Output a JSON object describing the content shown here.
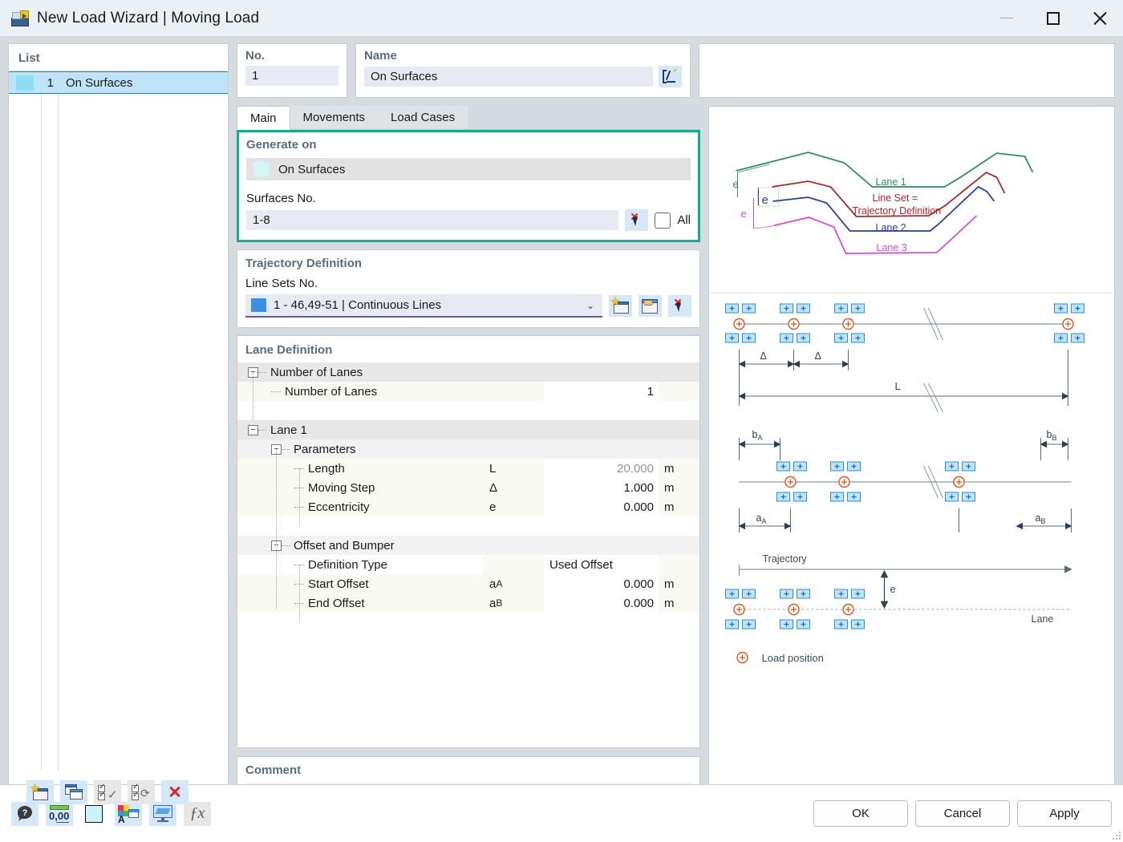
{
  "window": {
    "title": "New Load Wizard | Moving Load",
    "icon": "moving-load-icon",
    "minimize": "–",
    "maximize": "□",
    "close": "✕"
  },
  "list_panel": {
    "legend": "List",
    "rows": [
      {
        "swatch_color": "#8fdcf5",
        "no": "1",
        "name": "On Surfaces"
      }
    ],
    "toolbar": [
      {
        "name": "new-item-button",
        "icon": "new-window-icon"
      },
      {
        "name": "copy-item-button",
        "icon": "copy-window-icon"
      },
      {
        "name": "select-all-button",
        "icon": "check-all-icon"
      },
      {
        "name": "invert-selection-button",
        "icon": "invert-selection-icon"
      },
      {
        "name": "delete-item-button",
        "icon": "red-x-icon"
      }
    ]
  },
  "header": {
    "no_label": "No.",
    "no_value": "1",
    "name_label": "Name",
    "name_value": "On Surfaces",
    "name_edit_icon": "edit-pencil-icon"
  },
  "tabs": [
    {
      "label": "Main",
      "active": true
    },
    {
      "label": "Movements",
      "active": false
    },
    {
      "label": "Load Cases",
      "active": false
    }
  ],
  "generate_on": {
    "legend": "Generate on",
    "selected": "On Surfaces",
    "selected_swatch": "#d6f6f6",
    "surfaces_label": "Surfaces No.",
    "surfaces_value": "1-8",
    "pick_icon": "deselect-cursor-icon",
    "all_label": "All",
    "all_checked": false,
    "highlight_color": "#13ad8b"
  },
  "trajectory": {
    "legend": "Trajectory Definition",
    "line_sets_label": "Line Sets No.",
    "line_sets_value": "1 - 46,49-51 | Continuous Lines",
    "line_sets_swatch": "#3f8fdd",
    "buttons": [
      {
        "name": "new-line-set-button",
        "icon": "new-window-icon"
      },
      {
        "name": "edit-line-set-button",
        "icon": "edit-hand-icon"
      },
      {
        "name": "deselect-line-set-button",
        "icon": "deselect-cursor-icon"
      }
    ]
  },
  "lane_definition": {
    "legend": "Lane Definition",
    "rows": [
      {
        "type": "group",
        "indent": 0,
        "expander": "−",
        "label": "Number of Lanes",
        "symbol": "",
        "value": "",
        "unit": ""
      },
      {
        "type": "data",
        "indent": 1,
        "expander": "",
        "label": "Number of Lanes",
        "symbol": "",
        "value": "1",
        "unit": "",
        "dim": false
      },
      {
        "type": "spacer",
        "indent": 0,
        "expander": "",
        "label": "",
        "symbol": "",
        "value": "",
        "unit": ""
      },
      {
        "type": "group",
        "indent": 0,
        "expander": "−",
        "label": "Lane 1",
        "symbol": "",
        "value": "",
        "unit": ""
      },
      {
        "type": "sub",
        "indent": 1,
        "expander": "−",
        "label": "Parameters",
        "symbol": "",
        "value": "",
        "unit": ""
      },
      {
        "type": "data",
        "indent": 2,
        "expander": "",
        "label": "Length",
        "symbol": "L",
        "value": "20.000",
        "unit": "m",
        "dim": true
      },
      {
        "type": "data",
        "indent": 2,
        "expander": "",
        "label": "Moving Step",
        "symbol": "Δ",
        "value": "1.000",
        "unit": "m",
        "dim": false
      },
      {
        "type": "data",
        "indent": 2,
        "expander": "",
        "label": "Eccentricity",
        "symbol": "e",
        "value": "0.000",
        "unit": "m",
        "dim": false
      },
      {
        "type": "spacer",
        "indent": 0,
        "expander": "",
        "label": "",
        "symbol": "",
        "value": "",
        "unit": ""
      },
      {
        "type": "sub",
        "indent": 1,
        "expander": "−",
        "label": "Offset and Bumper",
        "symbol": "",
        "value": "",
        "unit": ""
      },
      {
        "type": "data",
        "indent": 2,
        "expander": "",
        "label": "Definition Type",
        "symbol": "",
        "value": "",
        "unit": "",
        "left_value": "Used Offset",
        "dim": false
      },
      {
        "type": "data",
        "indent": 2,
        "expander": "",
        "label": "Start Offset",
        "symbol": "aA",
        "value": "0.000",
        "unit": "m",
        "dim": false
      },
      {
        "type": "data",
        "indent": 2,
        "expander": "",
        "label": "End Offset",
        "symbol": "aB",
        "value": "0.000",
        "unit": "m",
        "dim": false
      }
    ]
  },
  "comment": {
    "legend": "Comment",
    "value": ""
  },
  "preview": {
    "lanes_diagram": {
      "lane1_label": "Lane 1",
      "lane1_color": "#2e8b63",
      "line_set_label_1": "Line Set =",
      "line_set_label_2": "Trajectory Definition",
      "line_set_color": "#a52a2a",
      "lane2_label": "Lane 2",
      "lane2_color": "#2b3f9e",
      "lane3_label": "Lane 3",
      "lane3_color": "#d44fd4",
      "e_label": "e"
    },
    "length_diagram": {
      "delta_label": "Δ",
      "length_label": "L"
    },
    "offset_diagram": {
      "bA_label": "b",
      "bA_sub": "A",
      "bB_label": "b",
      "bB_sub": "B",
      "aA_label": "a",
      "aA_sub": "A",
      "aB_label": "a",
      "aB_sub": "B"
    },
    "eccentricity_diagram": {
      "trajectory_label": "Trajectory",
      "lane_label": "Lane",
      "e_label": "e"
    },
    "legend_item": "Load position"
  },
  "bottom_bar": {
    "tools": [
      {
        "name": "help-button",
        "icon": "help-icon"
      },
      {
        "name": "units-button",
        "icon": "units-icon"
      },
      {
        "name": "color-button",
        "icon": "color-swatch-icon"
      },
      {
        "name": "display-properties-button",
        "icon": "palette-icon"
      },
      {
        "name": "view-button",
        "icon": "monitor-icon"
      },
      {
        "name": "formula-button",
        "icon": "fx-icon"
      }
    ],
    "ok": "OK",
    "cancel": "Cancel",
    "apply": "Apply"
  }
}
